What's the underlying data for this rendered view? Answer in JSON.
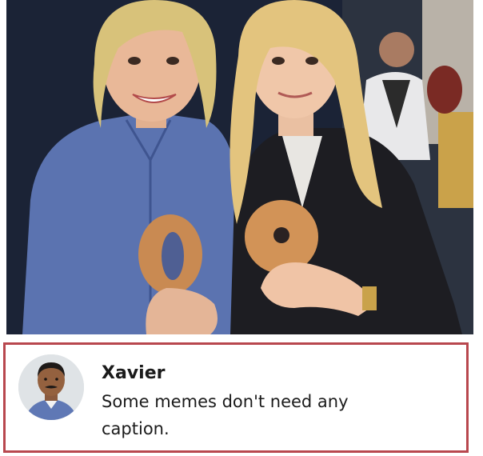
{
  "photo": {
    "description_icon": "meme-photo"
  },
  "comment": {
    "author": "Xavier",
    "text": "Some memes don't need any caption.",
    "border_color": "#b8474e"
  }
}
